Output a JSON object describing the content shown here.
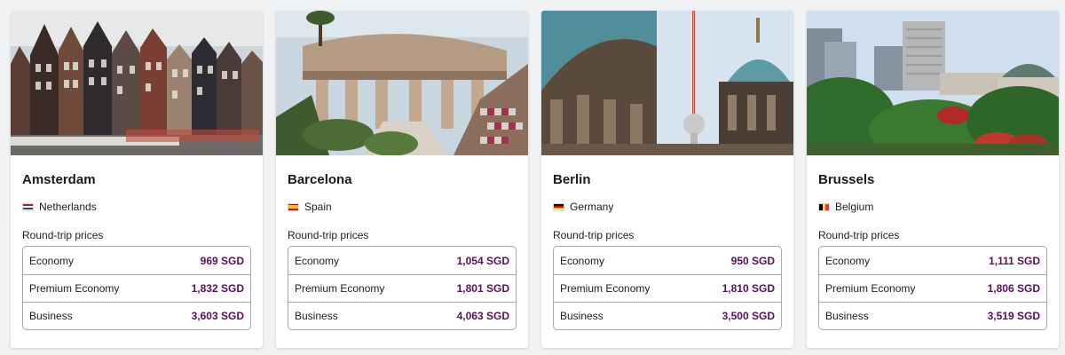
{
  "section": {
    "prices_heading": "Round-trip prices",
    "currency": "SGD"
  },
  "colors": {
    "price": "#5c0d5e",
    "table_border": "#a7a5b8"
  },
  "destinations": [
    {
      "city": "Amsterdam",
      "country": "Netherlands",
      "flag": "netherlands-flag",
      "photo": "amsterdam-canal-houses",
      "fares": [
        {
          "class": "Economy",
          "price": "969 SGD"
        },
        {
          "class": "Premium Economy",
          "price": "1,832 SGD"
        },
        {
          "class": "Business",
          "price": "3,603 SGD"
        }
      ]
    },
    {
      "city": "Barcelona",
      "country": "Spain",
      "flag": "spain-flag",
      "photo": "barcelona-park-guell",
      "fares": [
        {
          "class": "Economy",
          "price": "1,054 SGD"
        },
        {
          "class": "Premium Economy",
          "price": "1,801 SGD"
        },
        {
          "class": "Business",
          "price": "4,063 SGD"
        }
      ]
    },
    {
      "city": "Berlin",
      "country": "Germany",
      "flag": "germany-flag",
      "photo": "berlin-cathedral-tv-tower",
      "fares": [
        {
          "class": "Economy",
          "price": "950 SGD"
        },
        {
          "class": "Premium Economy",
          "price": "1,810 SGD"
        },
        {
          "class": "Business",
          "price": "3,500 SGD"
        }
      ]
    },
    {
      "city": "Brussels",
      "country": "Belgium",
      "flag": "belgium-flag",
      "photo": "brussels-skyline-garden",
      "fares": [
        {
          "class": "Economy",
          "price": "1,111 SGD"
        },
        {
          "class": "Premium Economy",
          "price": "1,806 SGD"
        },
        {
          "class": "Business",
          "price": "3,519 SGD"
        }
      ]
    }
  ]
}
